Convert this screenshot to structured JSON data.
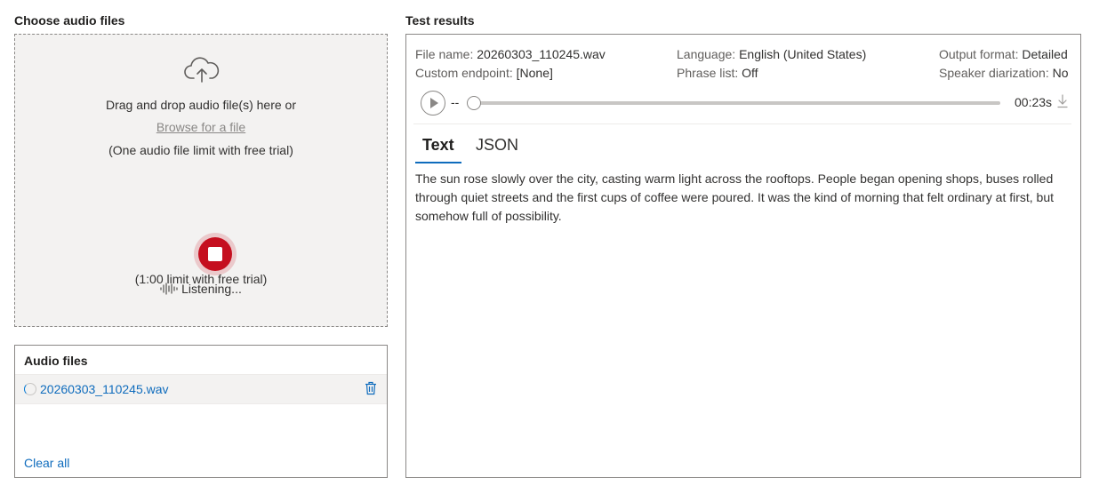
{
  "left_panel": {
    "title": "Choose audio files",
    "upload": {
      "drag_text": "Drag and drop audio file(s) here or",
      "browse_text": "Browse for a file",
      "limit_text": "(One audio file limit with free trial)",
      "icon": "cloud-upload-icon"
    },
    "recording": {
      "status": "Listening...",
      "limit_text": "(1:00 limit with free trial)",
      "stop_icon": "stop-icon",
      "wave_icon": "audio-wave-icon",
      "stop_color": "#c50f1f"
    },
    "audio_files": {
      "title": "Audio files",
      "files": [
        {
          "name": "20260303_110245.wav",
          "status_icon": "loading-spinner-icon",
          "action_icon": "delete-icon"
        }
      ],
      "clear_all_label": "Clear all"
    }
  },
  "right_panel": {
    "title": "Test results",
    "meta": {
      "file_name_label": "File name:",
      "file_name_value": "20260303_110245.wav",
      "custom_endpoint_label": "Custom endpoint:",
      "custom_endpoint_value": "[None]",
      "language_label": "Language:",
      "language_value": "English (United States)",
      "phrase_list_label": "Phrase list:",
      "phrase_list_value": "Off",
      "output_format_label": "Output format:",
      "output_format_value": "Detailed",
      "speaker_diarization_label": "Speaker diarization:",
      "speaker_diarization_value": "No"
    },
    "player": {
      "current_time": "--",
      "duration": "00:23s",
      "progress": 0.0
    },
    "tabs": [
      {
        "label": "Text",
        "selected": true
      },
      {
        "label": "JSON",
        "selected": false
      }
    ],
    "transcript": "The sun rose slowly over the city, casting warm light across the rooftops. People began opening shops, buses rolled through quiet streets and the first cups of coffee were poured. It was the kind of morning that felt ordinary at first, but somehow full of possibility."
  },
  "colors": {
    "accent": "#0f6cbd",
    "upload_bg": "#f3f2f1"
  }
}
